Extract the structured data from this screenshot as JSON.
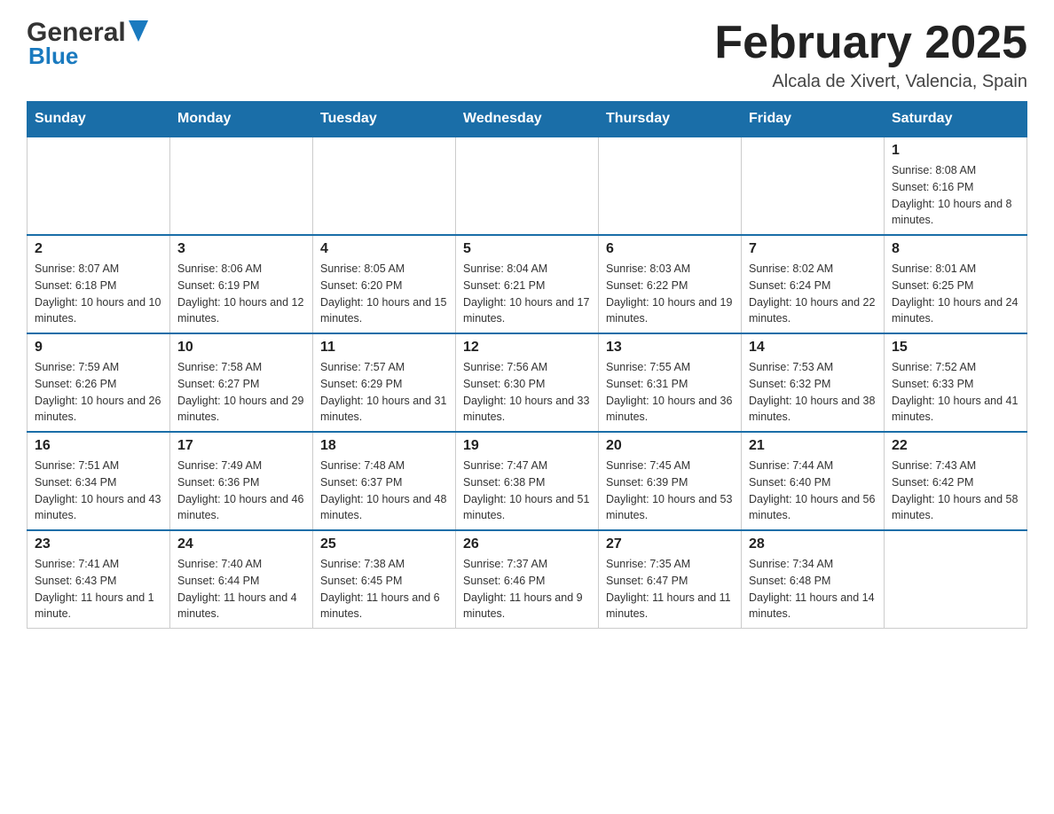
{
  "logo": {
    "general": "General",
    "blue": "Blue"
  },
  "header": {
    "title": "February 2025",
    "location": "Alcala de Xivert, Valencia, Spain"
  },
  "days_of_week": [
    "Sunday",
    "Monday",
    "Tuesday",
    "Wednesday",
    "Thursday",
    "Friday",
    "Saturday"
  ],
  "weeks": [
    [
      {
        "day": "",
        "info": ""
      },
      {
        "day": "",
        "info": ""
      },
      {
        "day": "",
        "info": ""
      },
      {
        "day": "",
        "info": ""
      },
      {
        "day": "",
        "info": ""
      },
      {
        "day": "",
        "info": ""
      },
      {
        "day": "1",
        "info": "Sunrise: 8:08 AM\nSunset: 6:16 PM\nDaylight: 10 hours and 8 minutes."
      }
    ],
    [
      {
        "day": "2",
        "info": "Sunrise: 8:07 AM\nSunset: 6:18 PM\nDaylight: 10 hours and 10 minutes."
      },
      {
        "day": "3",
        "info": "Sunrise: 8:06 AM\nSunset: 6:19 PM\nDaylight: 10 hours and 12 minutes."
      },
      {
        "day": "4",
        "info": "Sunrise: 8:05 AM\nSunset: 6:20 PM\nDaylight: 10 hours and 15 minutes."
      },
      {
        "day": "5",
        "info": "Sunrise: 8:04 AM\nSunset: 6:21 PM\nDaylight: 10 hours and 17 minutes."
      },
      {
        "day": "6",
        "info": "Sunrise: 8:03 AM\nSunset: 6:22 PM\nDaylight: 10 hours and 19 minutes."
      },
      {
        "day": "7",
        "info": "Sunrise: 8:02 AM\nSunset: 6:24 PM\nDaylight: 10 hours and 22 minutes."
      },
      {
        "day": "8",
        "info": "Sunrise: 8:01 AM\nSunset: 6:25 PM\nDaylight: 10 hours and 24 minutes."
      }
    ],
    [
      {
        "day": "9",
        "info": "Sunrise: 7:59 AM\nSunset: 6:26 PM\nDaylight: 10 hours and 26 minutes."
      },
      {
        "day": "10",
        "info": "Sunrise: 7:58 AM\nSunset: 6:27 PM\nDaylight: 10 hours and 29 minutes."
      },
      {
        "day": "11",
        "info": "Sunrise: 7:57 AM\nSunset: 6:29 PM\nDaylight: 10 hours and 31 minutes."
      },
      {
        "day": "12",
        "info": "Sunrise: 7:56 AM\nSunset: 6:30 PM\nDaylight: 10 hours and 33 minutes."
      },
      {
        "day": "13",
        "info": "Sunrise: 7:55 AM\nSunset: 6:31 PM\nDaylight: 10 hours and 36 minutes."
      },
      {
        "day": "14",
        "info": "Sunrise: 7:53 AM\nSunset: 6:32 PM\nDaylight: 10 hours and 38 minutes."
      },
      {
        "day": "15",
        "info": "Sunrise: 7:52 AM\nSunset: 6:33 PM\nDaylight: 10 hours and 41 minutes."
      }
    ],
    [
      {
        "day": "16",
        "info": "Sunrise: 7:51 AM\nSunset: 6:34 PM\nDaylight: 10 hours and 43 minutes."
      },
      {
        "day": "17",
        "info": "Sunrise: 7:49 AM\nSunset: 6:36 PM\nDaylight: 10 hours and 46 minutes."
      },
      {
        "day": "18",
        "info": "Sunrise: 7:48 AM\nSunset: 6:37 PM\nDaylight: 10 hours and 48 minutes."
      },
      {
        "day": "19",
        "info": "Sunrise: 7:47 AM\nSunset: 6:38 PM\nDaylight: 10 hours and 51 minutes."
      },
      {
        "day": "20",
        "info": "Sunrise: 7:45 AM\nSunset: 6:39 PM\nDaylight: 10 hours and 53 minutes."
      },
      {
        "day": "21",
        "info": "Sunrise: 7:44 AM\nSunset: 6:40 PM\nDaylight: 10 hours and 56 minutes."
      },
      {
        "day": "22",
        "info": "Sunrise: 7:43 AM\nSunset: 6:42 PM\nDaylight: 10 hours and 58 minutes."
      }
    ],
    [
      {
        "day": "23",
        "info": "Sunrise: 7:41 AM\nSunset: 6:43 PM\nDaylight: 11 hours and 1 minute."
      },
      {
        "day": "24",
        "info": "Sunrise: 7:40 AM\nSunset: 6:44 PM\nDaylight: 11 hours and 4 minutes."
      },
      {
        "day": "25",
        "info": "Sunrise: 7:38 AM\nSunset: 6:45 PM\nDaylight: 11 hours and 6 minutes."
      },
      {
        "day": "26",
        "info": "Sunrise: 7:37 AM\nSunset: 6:46 PM\nDaylight: 11 hours and 9 minutes."
      },
      {
        "day": "27",
        "info": "Sunrise: 7:35 AM\nSunset: 6:47 PM\nDaylight: 11 hours and 11 minutes."
      },
      {
        "day": "28",
        "info": "Sunrise: 7:34 AM\nSunset: 6:48 PM\nDaylight: 11 hours and 14 minutes."
      },
      {
        "day": "",
        "info": ""
      }
    ]
  ]
}
